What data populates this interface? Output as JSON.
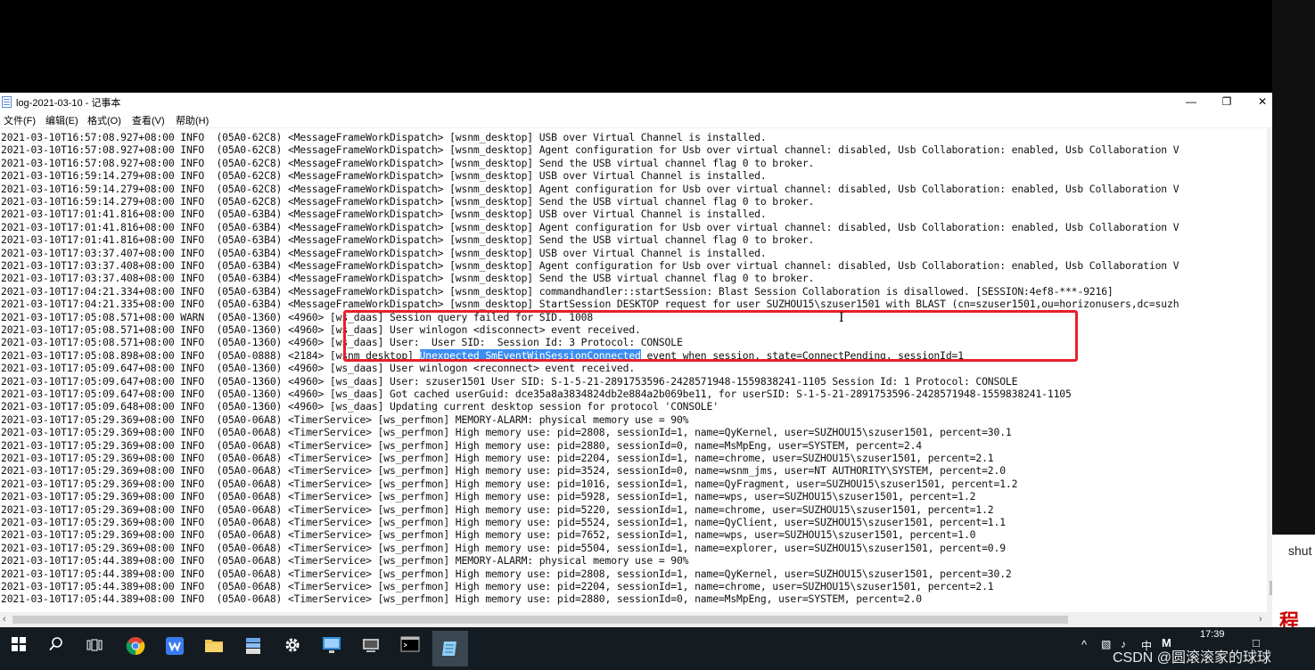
{
  "window": {
    "title": "log-2021-03-10 - 记事本",
    "minimize": "—",
    "maximize": "❐",
    "close": "✕"
  },
  "menu": [
    "文件(F)",
    "编辑(E)",
    "格式(O)",
    "查看(V)",
    "帮助(H)"
  ],
  "log_lines": [
    "2021-03-10T16:57:08.927+08:00 INFO  (05A0-62C8) <MessageFrameWorkDispatch> [wsnm_desktop] USB over Virtual Channel is installed.",
    "2021-03-10T16:57:08.927+08:00 INFO  (05A0-62C8) <MessageFrameWorkDispatch> [wsnm_desktop] Agent configuration for Usb over virtual channel: disabled, Usb Collaboration: enabled, Usb Collaboration V",
    "2021-03-10T16:57:08.927+08:00 INFO  (05A0-62C8) <MessageFrameWorkDispatch> [wsnm_desktop] Send the USB virtual channel flag 0 to broker.",
    "2021-03-10T16:59:14.279+08:00 INFO  (05A0-62C8) <MessageFrameWorkDispatch> [wsnm_desktop] USB over Virtual Channel is installed.",
    "2021-03-10T16:59:14.279+08:00 INFO  (05A0-62C8) <MessageFrameWorkDispatch> [wsnm_desktop] Agent configuration for Usb over virtual channel: disabled, Usb Collaboration: enabled, Usb Collaboration V",
    "2021-03-10T16:59:14.279+08:00 INFO  (05A0-62C8) <MessageFrameWorkDispatch> [wsnm_desktop] Send the USB virtual channel flag 0 to broker.",
    "2021-03-10T17:01:41.816+08:00 INFO  (05A0-63B4) <MessageFrameWorkDispatch> [wsnm_desktop] USB over Virtual Channel is installed.",
    "2021-03-10T17:01:41.816+08:00 INFO  (05A0-63B4) <MessageFrameWorkDispatch> [wsnm_desktop] Agent configuration for Usb over virtual channel: disabled, Usb Collaboration: enabled, Usb Collaboration V",
    "2021-03-10T17:01:41.816+08:00 INFO  (05A0-63B4) <MessageFrameWorkDispatch> [wsnm_desktop] Send the USB virtual channel flag 0 to broker.",
    "2021-03-10T17:03:37.407+08:00 INFO  (05A0-63B4) <MessageFrameWorkDispatch> [wsnm_desktop] USB over Virtual Channel is installed.",
    "2021-03-10T17:03:37.408+08:00 INFO  (05A0-63B4) <MessageFrameWorkDispatch> [wsnm_desktop] Agent configuration for Usb over virtual channel: disabled, Usb Collaboration: enabled, Usb Collaboration V",
    "2021-03-10T17:03:37.408+08:00 INFO  (05A0-63B4) <MessageFrameWorkDispatch> [wsnm_desktop] Send the USB virtual channel flag 0 to broker.",
    "2021-03-10T17:04:21.334+08:00 INFO  (05A0-63B4) <MessageFrameWorkDispatch> [wsnm_desktop] commandhandler::startSession: Blast Session Collaboration is disallowed. [SESSION:4ef8-***-9216]",
    "2021-03-10T17:04:21.335+08:00 INFO  (05A0-63B4) <MessageFrameWorkDispatch> [wsnm_desktop] StartSession DESKTOP request for user SUZHOU15\\szuser1501 with BLAST (cn=szuser1501,ou=horizonusers,dc=suzh",
    "2021-03-10T17:05:08.571+08:00 WARN  (05A0-1360) <4960> [ws_daas] Session query failed for SID. 1008",
    "2021-03-10T17:05:08.571+08:00 INFO  (05A0-1360) <4960> [ws_daas] User winlogon <disconnect> event received.",
    "2021-03-10T17:05:08.571+08:00 INFO  (05A0-1360) <4960> [ws_daas] User:  User SID:  Session Id: 3 Protocol: CONSOLE",
    "2021-03-10T17:05:08.898+08:00 INFO  (05A0-0888) <2184> [wsnm_desktop] Unexpected SmEventWinSessionConnected event when session, state=ConnectPending, sessionId=1",
    "2021-03-10T17:05:09.647+08:00 INFO  (05A0-1360) <4960> [ws_daas] User winlogon <reconnect> event received.",
    "2021-03-10T17:05:09.647+08:00 INFO  (05A0-1360) <4960> [ws_daas] User: szuser1501 User SID: S-1-5-21-2891753596-2428571948-1559838241-1105 Session Id: 1 Protocol: CONSOLE",
    "2021-03-10T17:05:09.647+08:00 INFO  (05A0-1360) <4960> [ws_daas] Got cached userGuid: dce35a8a3834824db2e884a2b069be11, for userSID: S-1-5-21-2891753596-2428571948-1559838241-1105",
    "2021-03-10T17:05:09.648+08:00 INFO  (05A0-1360) <4960> [ws_daas] Updating current desktop session for protocol 'CONSOLE'",
    "2021-03-10T17:05:29.369+08:00 INFO  (05A0-06A8) <TimerService> [ws_perfmon] MEMORY-ALARM: physical memory use = 90%",
    "2021-03-10T17:05:29.369+08:00 INFO  (05A0-06A8) <TimerService> [ws_perfmon] High memory use: pid=2808, sessionId=1, name=QyKernel, user=SUZHOU15\\szuser1501, percent=30.1",
    "2021-03-10T17:05:29.369+08:00 INFO  (05A0-06A8) <TimerService> [ws_perfmon] High memory use: pid=2880, sessionId=0, name=MsMpEng, user=SYSTEM, percent=2.4",
    "2021-03-10T17:05:29.369+08:00 INFO  (05A0-06A8) <TimerService> [ws_perfmon] High memory use: pid=2204, sessionId=1, name=chrome, user=SUZHOU15\\szuser1501, percent=2.1",
    "2021-03-10T17:05:29.369+08:00 INFO  (05A0-06A8) <TimerService> [ws_perfmon] High memory use: pid=3524, sessionId=0, name=wsnm_jms, user=NT AUTHORITY\\SYSTEM, percent=2.0",
    "2021-03-10T17:05:29.369+08:00 INFO  (05A0-06A8) <TimerService> [ws_perfmon] High memory use: pid=1016, sessionId=1, name=QyFragment, user=SUZHOU15\\szuser1501, percent=1.2",
    "2021-03-10T17:05:29.369+08:00 INFO  (05A0-06A8) <TimerService> [ws_perfmon] High memory use: pid=5928, sessionId=1, name=wps, user=SUZHOU15\\szuser1501, percent=1.2",
    "2021-03-10T17:05:29.369+08:00 INFO  (05A0-06A8) <TimerService> [ws_perfmon] High memory use: pid=5220, sessionId=1, name=chrome, user=SUZHOU15\\szuser1501, percent=1.2",
    "2021-03-10T17:05:29.369+08:00 INFO  (05A0-06A8) <TimerService> [ws_perfmon] High memory use: pid=5524, sessionId=1, name=QyClient, user=SUZHOU15\\szuser1501, percent=1.1",
    "2021-03-10T17:05:29.369+08:00 INFO  (05A0-06A8) <TimerService> [ws_perfmon] High memory use: pid=7652, sessionId=1, name=wps, user=SUZHOU15\\szuser1501, percent=1.0",
    "2021-03-10T17:05:29.369+08:00 INFO  (05A0-06A8) <TimerService> [ws_perfmon] High memory use: pid=5504, sessionId=1, name=explorer, user=SUZHOU15\\szuser1501, percent=0.9",
    "2021-03-10T17:05:44.389+08:00 INFO  (05A0-06A8) <TimerService> [ws_perfmon] MEMORY-ALARM: physical memory use = 90%",
    "2021-03-10T17:05:44.389+08:00 INFO  (05A0-06A8) <TimerService> [ws_perfmon] High memory use: pid=2808, sessionId=1, name=QyKernel, user=SUZHOU15\\szuser1501, percent=30.2",
    "2021-03-10T17:05:44.389+08:00 INFO  (05A0-06A8) <TimerService> [ws_perfmon] High memory use: pid=2204, sessionId=1, name=chrome, user=SUZHOU15\\szuser1501, percent=2.1",
    "2021-03-10T17:05:44.389+08:00 INFO  (05A0-06A8) <TimerService> [ws_perfmon] High memory use: pid=2880, sessionId=0, name=MsMpEng, user=SYSTEM, percent=2.0"
  ],
  "selected_line_index": 17,
  "selected_text": "Unexpected SmEventWinSessionConnected",
  "colors": {
    "selection": "#3c8ef0",
    "highlight_box": "#e8202a",
    "taskbar": "#151c21"
  },
  "taskbar": {
    "icons": [
      "windows-icon",
      "search-icon",
      "task-view-icon",
      "chrome-icon",
      "wps-icon",
      "file-explorer-icon",
      "server-manager-icon",
      "settings-icon",
      "remote-desktop-icon",
      "network-icon",
      "cmd-icon",
      "notepad-icon"
    ],
    "tray_ime": "中",
    "tray_clock": "17:39"
  },
  "background_page": {
    "snippet": "shut",
    "link_text": "程"
  },
  "watermark": "CSDN @圆滚滚家的球球"
}
